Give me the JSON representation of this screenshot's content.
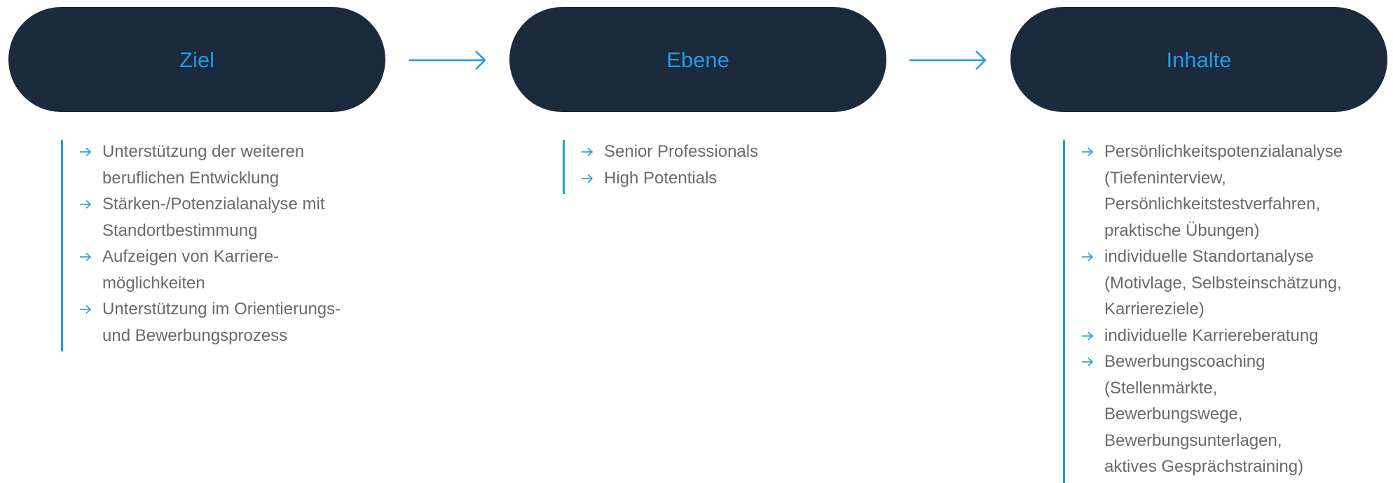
{
  "colors": {
    "pill_background": "#1b2a3d",
    "accent": "#1f9be6",
    "body_text": "#6a6a6a"
  },
  "stages": [
    {
      "title": "Ziel",
      "items": [
        [
          "Unterstützung der weiteren",
          "beruflichen Entwicklung"
        ],
        [
          "Stärken-/Potenzialanalyse mit",
          "Standortbestimmung"
        ],
        [
          "Aufzeigen von Karriere-",
          "möglichkeiten"
        ],
        [
          "Unterstützung im Orientierungs-",
          "und Bewerbungsprozess"
        ]
      ]
    },
    {
      "title": "Ebene",
      "items": [
        [
          "Senior Professionals"
        ],
        [
          "High Potentials"
        ]
      ]
    },
    {
      "title": "Inhalte",
      "items": [
        [
          "Persönlichkeitspotenzialanalyse",
          "(Tiefeninterview,",
          "Persönlichkeitstestverfahren,",
          "praktische Übungen)"
        ],
        [
          "individuelle Standortanalyse",
          "(Motivlage, Selbsteinschätzung,",
          "Karriereziele)"
        ],
        [
          "individuelle Karriereberatung"
        ],
        [
          "Bewerbungscoaching",
          "(Stellenmärkte,",
          "Bewerbungswege,",
          "Bewerbungsunterlagen,",
          "aktives Gesprächstraining)"
        ]
      ]
    }
  ],
  "icons": {
    "connector": "arrow-right-icon",
    "bullet": "arrow-right-icon"
  }
}
